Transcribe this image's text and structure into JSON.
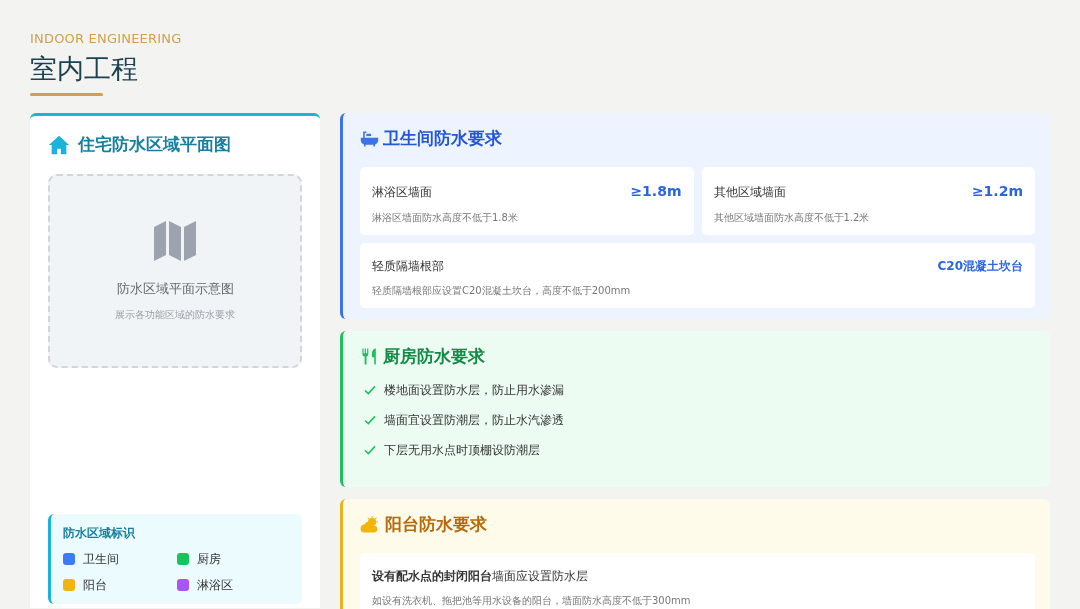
{
  "header": {
    "subtitle": "INDOOR ENGINEERING",
    "title": "室内工程"
  },
  "floor_plan": {
    "title": "住宅防水区域平面图",
    "placeholder": {
      "caption": "防水区域平面示意图",
      "note": "展示各功能区域的防水要求"
    },
    "legend": {
      "title": "防水区域标识",
      "items": [
        {
          "label": "卫生间",
          "color": "#3b7cf6"
        },
        {
          "label": "厨房",
          "color": "#16c45a"
        },
        {
          "label": "阳台",
          "color": "#f2b50c"
        },
        {
          "label": "淋浴区",
          "color": "#a855f7"
        }
      ]
    }
  },
  "sections": [
    {
      "kind": "cards",
      "title": "卫生间防水要求",
      "items": [
        {
          "label": "淋浴区墙面",
          "value": "≥1.8m",
          "note": "淋浴区墙面防水高度不低于1.8米"
        },
        {
          "label": "其他区域墙面",
          "value": "≥1.2m",
          "note": "其他区域墙面防水高度不低于1.2米"
        },
        {
          "label": "轻质隔墙根部",
          "value": "C20混凝土坎台",
          "note": "轻质隔墙根部应设置C20混凝土坎台，高度不低于200mm"
        }
      ]
    },
    {
      "kind": "checklist",
      "title": "厨房防水要求",
      "items": [
        "楼地面设置防水层，防止用水渗漏",
        "墙面宜设置防潮层，防止水汽渗透",
        "下层无用水点时顶棚设防潮层"
      ]
    },
    {
      "kind": "notes",
      "title": "阳台防水要求",
      "items": [
        {
          "text": "**设有配水点的封闭阳台**墙面应设置防水层",
          "note": "如设有洗衣机、拖把池等用水设备的阳台，墙面防水高度不低于300mm"
        }
      ]
    }
  ]
}
